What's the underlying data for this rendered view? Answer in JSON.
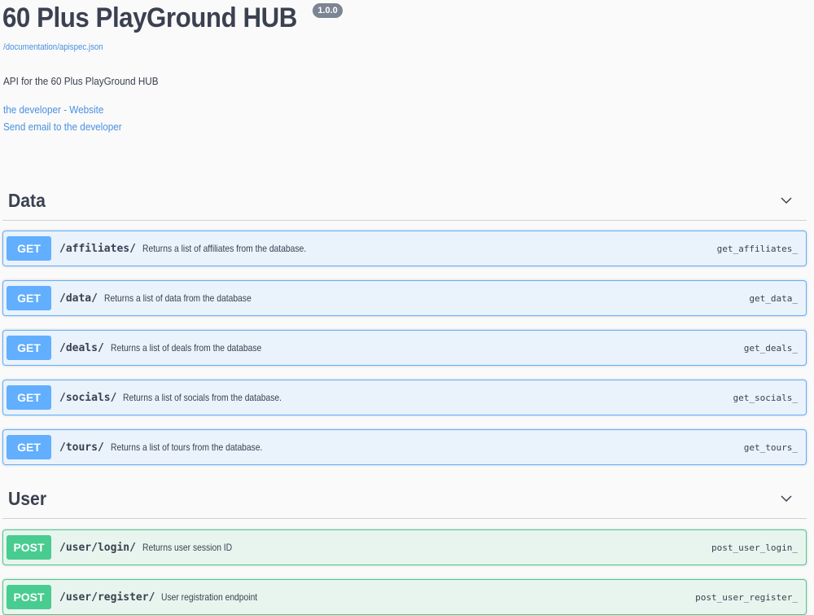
{
  "info": {
    "title": "60 Plus PlayGround HUB",
    "version": "1.0.0",
    "spec_url": "/documentation/apispec.json",
    "description": "API for the 60 Plus PlayGround HUB",
    "contact_website": "the developer - Website",
    "contact_email": "Send email to the developer"
  },
  "colors": {
    "get": "#61affe",
    "post": "#49cc90",
    "link": "#4990e2",
    "text": "#3b4151"
  },
  "sections": [
    {
      "name": "Data",
      "icon": "chevron-down-icon",
      "operations": [
        {
          "method": "GET",
          "path": "/affiliates/",
          "summary": "Returns a list of affiliates from the database.",
          "operation_id": "get_affiliates_"
        },
        {
          "method": "GET",
          "path": "/data/",
          "summary": "Returns a list of data from the database",
          "operation_id": "get_data_"
        },
        {
          "method": "GET",
          "path": "/deals/",
          "summary": "Returns a list of deals from the database",
          "operation_id": "get_deals_"
        },
        {
          "method": "GET",
          "path": "/socials/",
          "summary": "Returns a list of socials from the database.",
          "operation_id": "get_socials_"
        },
        {
          "method": "GET",
          "path": "/tours/",
          "summary": "Returns a list of tours from the database.",
          "operation_id": "get_tours_"
        }
      ]
    },
    {
      "name": "User",
      "icon": "chevron-down-icon",
      "operations": [
        {
          "method": "POST",
          "path": "/user/login/",
          "summary": "Returns user session ID",
          "operation_id": "post_user_login_"
        },
        {
          "method": "POST",
          "path": "/user/register/",
          "summary": "User registration endpoint",
          "operation_id": "post_user_register_"
        }
      ]
    }
  ]
}
